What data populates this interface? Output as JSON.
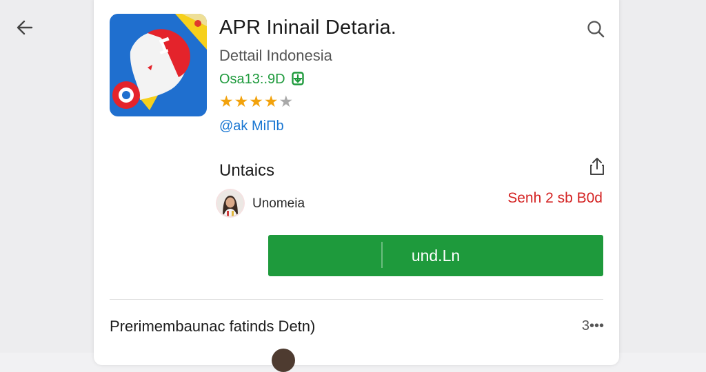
{
  "app": {
    "title": "APR Ininail Detaria.",
    "developer": "Dettail Indonesia",
    "price": "Osa13:.9D",
    "price_icon": "download-icon",
    "rating": 4,
    "rating_max": 5,
    "link_text": "@ak MiПb"
  },
  "section": {
    "title": "Untaics",
    "user_name": "Unomeia",
    "meta_red": "Senh 2 sb B0d",
    "button_label": "und.Ln"
  },
  "bottom": {
    "title": "Prerimembaunac fatinds Detn)",
    "count": "3•••"
  },
  "icons": {
    "back": "arrow-left-icon",
    "search": "search-icon",
    "share": "share-icon"
  },
  "colors": {
    "accent_green": "#1e9a3c",
    "link_blue": "#1976d2",
    "alert_red": "#d42323",
    "star": "#f2a20c"
  }
}
